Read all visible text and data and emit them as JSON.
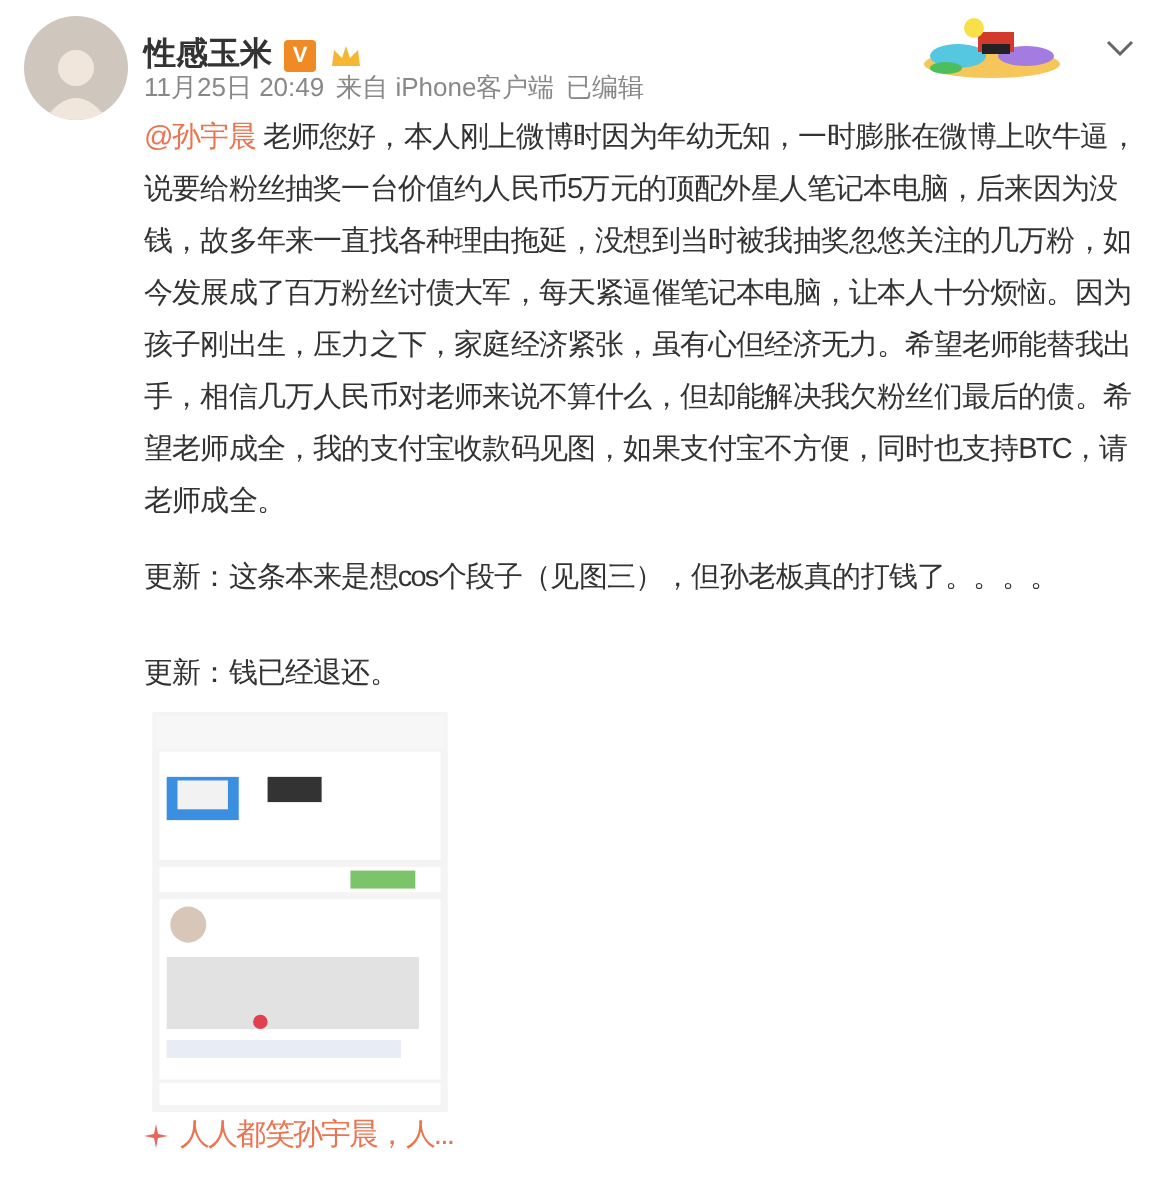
{
  "author": {
    "name": "性感玉米",
    "badge": "V",
    "verified": true
  },
  "meta": {
    "time": "11月25日 20:49",
    "source": "来自 iPhone客户端",
    "edited": "已编辑"
  },
  "post": {
    "mention": "@孙宇晨",
    "text": " 老师您好，本人刚上微博时因为年幼无知，一时膨胀在微博上吹牛逼，说要给粉丝抽奖一台价值约人民币5万元的顶配外星人笔记本电脑，后来因为没钱，故多年来一直找各种理由拖延，没想到当时被我抽奖忽悠关注的几万粉，如今发展成了百万粉丝讨债大军，每天紧逼催笔记本电脑，让本人十分烦恼。因为孩子刚出生，压力之下，家庭经济紧张，虽有心但经济无力。希望老师能替我出手，相信几万人民币对老师来说不算什么，但却能解决我欠粉丝们最后的债。希望老师成全，我的支付宝收款码见图，如果支付宝不方便，同时也支持BTC，请老师成全。",
    "updates": [
      "更新：这条本来是想cos个段子（见图三），但孙老板真的打钱了。。。。",
      "更新：钱已经退还。"
    ]
  },
  "link": {
    "text": "人人都笑孙宇晨，人..."
  }
}
